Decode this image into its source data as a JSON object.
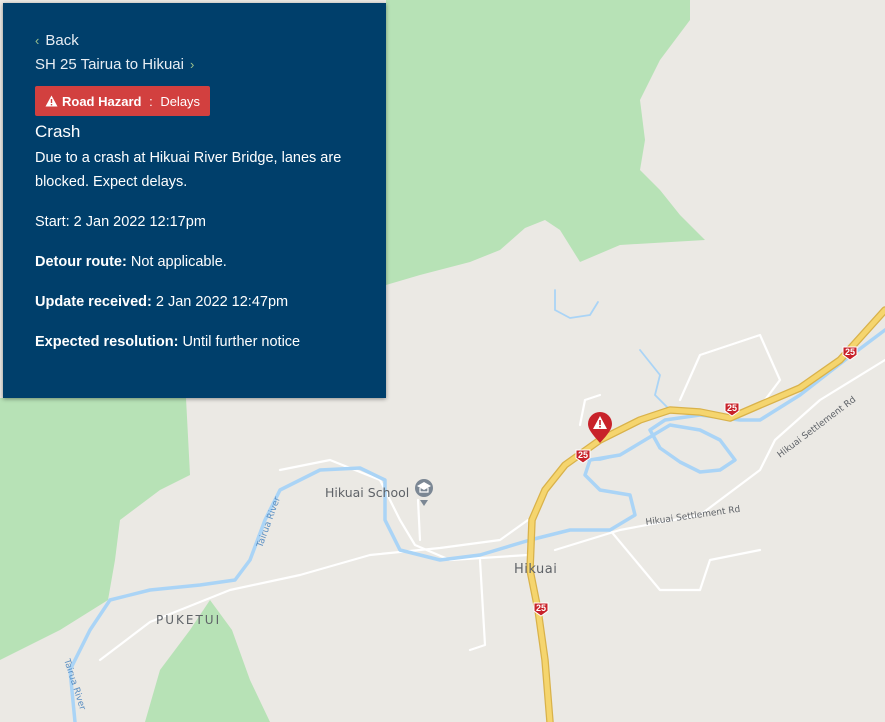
{
  "panel": {
    "back_label": "Back",
    "route_label": "SH 25 Tairua to Hikuai",
    "badge_type": "Road Hazard",
    "badge_separator": " : ",
    "badge_value": "Delays",
    "title": "Crash",
    "description": "Due to a crash at Hikuai River Bridge, lanes are blocked. Expect delays.",
    "start": "Start: 2 Jan 2022 12:17pm",
    "detour_label": "Detour route:",
    "detour_value": "Not applicable.",
    "update_label": "Update received:",
    "update_value": "2 Jan 2022 12:47pm",
    "resolution_label": "Expected resolution:",
    "resolution_value": "Until further notice"
  },
  "map": {
    "place_hikuai": "Hikuai",
    "place_puketui": "PUKETUI",
    "poi_school": "Hikuai School",
    "road_settlement_1": "Hikuai Settlement Rd",
    "road_settlement_2": "Hikuai Settlement Rd",
    "river_label_1": "Tairua River",
    "river_label_2": "Tairua River",
    "highway_shield": "25",
    "colors": {
      "park": "#b7e2b6",
      "land": "#ebe9e4",
      "water": "#aad4f6",
      "highway": "#f5d56e",
      "incident": "#c8222a",
      "panel": "#003f6b",
      "badge": "#d2403f"
    },
    "icons": [
      "school-icon",
      "hazard-marker-icon",
      "warning-icon"
    ]
  }
}
